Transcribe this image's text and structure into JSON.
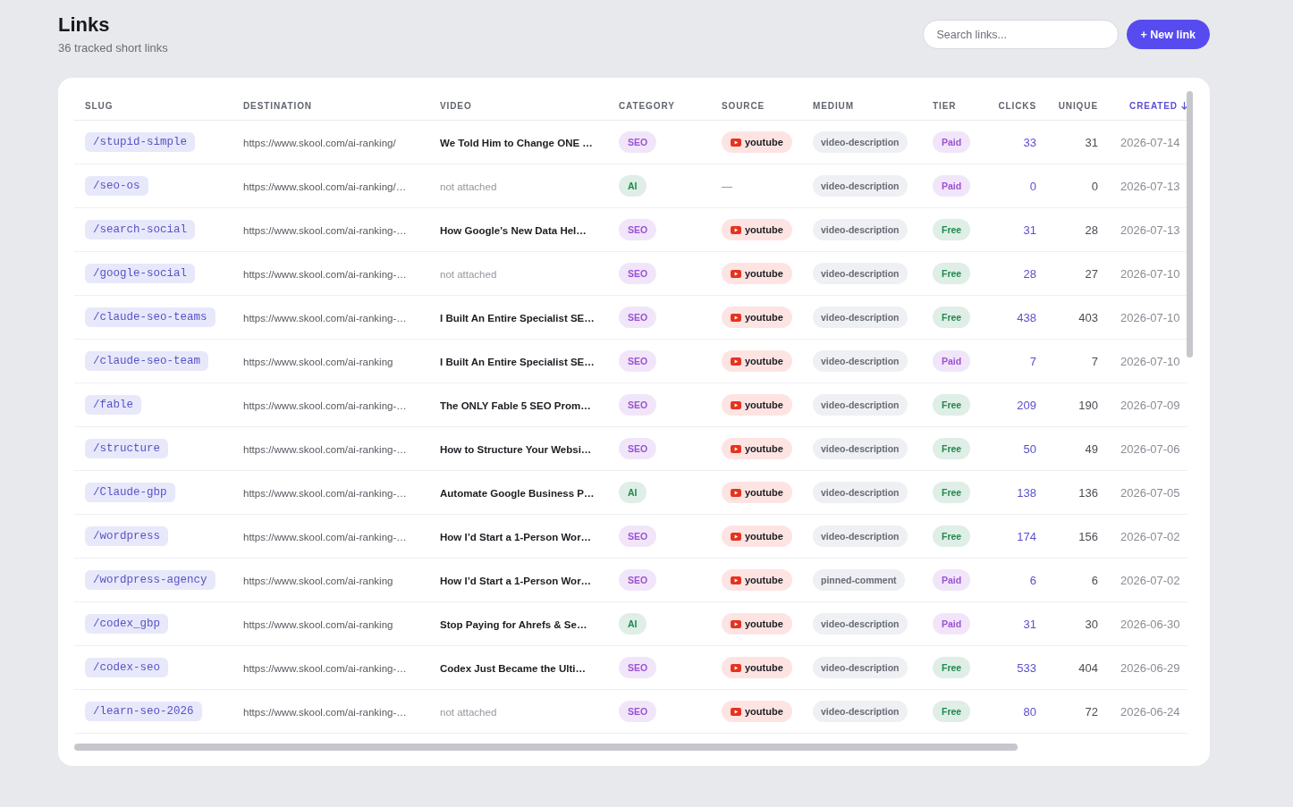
{
  "header": {
    "title": "Links",
    "subtitle": "36 tracked short links",
    "search": {
      "placeholder": "Search links..."
    },
    "new_button": "+ New link"
  },
  "table": {
    "columns": [
      {
        "label": "SLUG",
        "sorted": false
      },
      {
        "label": "DESTINATION",
        "sorted": false
      },
      {
        "label": "VIDEO",
        "sorted": false
      },
      {
        "label": "CATEGORY",
        "sorted": false
      },
      {
        "label": "SOURCE",
        "sorted": false
      },
      {
        "label": "MEDIUM",
        "sorted": false
      },
      {
        "label": "TIER",
        "sorted": false
      },
      {
        "label": "CLICKS",
        "sorted": false
      },
      {
        "label": "UNIQUE",
        "sorted": false
      },
      {
        "label": "CREATED",
        "sorted": true
      }
    ],
    "rows": [
      {
        "slug": "/stupid-simple",
        "destination": "https://www.skool.com/ai-ranking/",
        "video": {
          "text": "We Told Him to Change ONE …",
          "attached": true
        },
        "category": {
          "label": "SEO",
          "color": "#9b51d4"
        },
        "source": {
          "kind": "channel",
          "label": "youtube"
        },
        "medium": "video-description",
        "tier": {
          "label": "Paid",
          "color": "#9b51d4"
        },
        "clicks": "33",
        "unique": "31",
        "created": "2026-07-14"
      },
      {
        "slug": "/seo-os",
        "destination": "https://www.skool.com/ai-ranking/…",
        "video": {
          "text": "not attached",
          "attached": false
        },
        "category": {
          "label": "AI",
          "color": "#1f8a4c"
        },
        "source": {
          "kind": "empty",
          "label": "—"
        },
        "medium": "video-description",
        "tier": {
          "label": "Paid",
          "color": "#9b51d4"
        },
        "clicks": "0",
        "unique": "0",
        "created": "2026-07-13"
      },
      {
        "slug": "/search-social",
        "destination": "https://www.skool.com/ai-ranking-…",
        "video": {
          "text": "How Google’s New Data Hel…",
          "attached": true
        },
        "category": {
          "label": "SEO",
          "color": "#9b51d4"
        },
        "source": {
          "kind": "channel",
          "label": "youtube"
        },
        "medium": "video-description",
        "tier": {
          "label": "Free",
          "color": "#1f8a4c"
        },
        "clicks": "31",
        "unique": "28",
        "created": "2026-07-13"
      },
      {
        "slug": "/google-social",
        "destination": "https://www.skool.com/ai-ranking-…",
        "video": {
          "text": "not attached",
          "attached": false
        },
        "category": {
          "label": "SEO",
          "color": "#9b51d4"
        },
        "source": {
          "kind": "channel",
          "label": "youtube"
        },
        "medium": "video-description",
        "tier": {
          "label": "Free",
          "color": "#1f8a4c"
        },
        "clicks": "28",
        "unique": "27",
        "created": "2026-07-10"
      },
      {
        "slug": "/claude-seo-teams",
        "destination": "https://www.skool.com/ai-ranking-…",
        "video": {
          "text": "I Built An Entire Specialist SE…",
          "attached": true
        },
        "category": {
          "label": "SEO",
          "color": "#9b51d4"
        },
        "source": {
          "kind": "channel",
          "label": "youtube"
        },
        "medium": "video-description",
        "tier": {
          "label": "Free",
          "color": "#1f8a4c"
        },
        "clicks": "438",
        "unique": "403",
        "created": "2026-07-10"
      },
      {
        "slug": "/claude-seo-team",
        "destination": "https://www.skool.com/ai-ranking",
        "video": {
          "text": "I Built An Entire Specialist SE…",
          "attached": true
        },
        "category": {
          "label": "SEO",
          "color": "#9b51d4"
        },
        "source": {
          "kind": "channel",
          "label": "youtube"
        },
        "medium": "video-description",
        "tier": {
          "label": "Paid",
          "color": "#9b51d4"
        },
        "clicks": "7",
        "unique": "7",
        "created": "2026-07-10"
      },
      {
        "slug": "/fable",
        "destination": "https://www.skool.com/ai-ranking-…",
        "video": {
          "text": "The ONLY Fable 5 SEO Prom…",
          "attached": true
        },
        "category": {
          "label": "SEO",
          "color": "#9b51d4"
        },
        "source": {
          "kind": "channel",
          "label": "youtube"
        },
        "medium": "video-description",
        "tier": {
          "label": "Free",
          "color": "#1f8a4c"
        },
        "clicks": "209",
        "unique": "190",
        "created": "2026-07-09"
      },
      {
        "slug": "/structure",
        "destination": "https://www.skool.com/ai-ranking-…",
        "video": {
          "text": "How to Structure Your Websi…",
          "attached": true
        },
        "category": {
          "label": "SEO",
          "color": "#9b51d4"
        },
        "source": {
          "kind": "channel",
          "label": "youtube"
        },
        "medium": "video-description",
        "tier": {
          "label": "Free",
          "color": "#1f8a4c"
        },
        "clicks": "50",
        "unique": "49",
        "created": "2026-07-06"
      },
      {
        "slug": "/Claude-gbp",
        "destination": "https://www.skool.com/ai-ranking-…",
        "video": {
          "text": "Automate Google Business P…",
          "attached": true
        },
        "category": {
          "label": "AI",
          "color": "#1f8a4c"
        },
        "source": {
          "kind": "channel",
          "label": "youtube"
        },
        "medium": "video-description",
        "tier": {
          "label": "Free",
          "color": "#1f8a4c"
        },
        "clicks": "138",
        "unique": "136",
        "created": "2026-07-05"
      },
      {
        "slug": "/wordpress",
        "destination": "https://www.skool.com/ai-ranking-…",
        "video": {
          "text": "How I’d Start a 1-Person Wor…",
          "attached": true
        },
        "category": {
          "label": "SEO",
          "color": "#9b51d4"
        },
        "source": {
          "kind": "channel",
          "label": "youtube"
        },
        "medium": "video-description",
        "tier": {
          "label": "Free",
          "color": "#1f8a4c"
        },
        "clicks": "174",
        "unique": "156",
        "created": "2026-07-02"
      },
      {
        "slug": "/wordpress-agency",
        "destination": "https://www.skool.com/ai-ranking",
        "video": {
          "text": "How I’d Start a 1-Person Wor…",
          "attached": true
        },
        "category": {
          "label": "SEO",
          "color": "#9b51d4"
        },
        "source": {
          "kind": "channel",
          "label": "youtube"
        },
        "medium": "pinned-comment",
        "tier": {
          "label": "Paid",
          "color": "#9b51d4"
        },
        "clicks": "6",
        "unique": "6",
        "created": "2026-07-02"
      },
      {
        "slug": "/codex_gbp",
        "destination": "https://www.skool.com/ai-ranking",
        "video": {
          "text": "Stop Paying for Ahrefs & Se…",
          "attached": true
        },
        "category": {
          "label": "AI",
          "color": "#1f8a4c"
        },
        "source": {
          "kind": "channel",
          "label": "youtube"
        },
        "medium": "video-description",
        "tier": {
          "label": "Paid",
          "color": "#9b51d4"
        },
        "clicks": "31",
        "unique": "30",
        "created": "2026-06-30"
      },
      {
        "slug": "/codex-seo",
        "destination": "https://www.skool.com/ai-ranking-…",
        "video": {
          "text": "Codex Just Became the Ulti…",
          "attached": true
        },
        "category": {
          "label": "SEO",
          "color": "#9b51d4"
        },
        "source": {
          "kind": "channel",
          "label": "youtube"
        },
        "medium": "video-description",
        "tier": {
          "label": "Free",
          "color": "#1f8a4c"
        },
        "clicks": "533",
        "unique": "404",
        "created": "2026-06-29"
      },
      {
        "slug": "/learn-seo-2026",
        "destination": "https://www.skool.com/ai-ranking-…",
        "video": {
          "text": "not attached",
          "attached": false
        },
        "category": {
          "label": "SEO",
          "color": "#9b51d4"
        },
        "source": {
          "kind": "channel",
          "label": "youtube"
        },
        "medium": "video-description",
        "tier": {
          "label": "Free",
          "color": "#1f8a4c"
        },
        "clicks": "80",
        "unique": "72",
        "created": "2026-06-24"
      }
    ]
  }
}
